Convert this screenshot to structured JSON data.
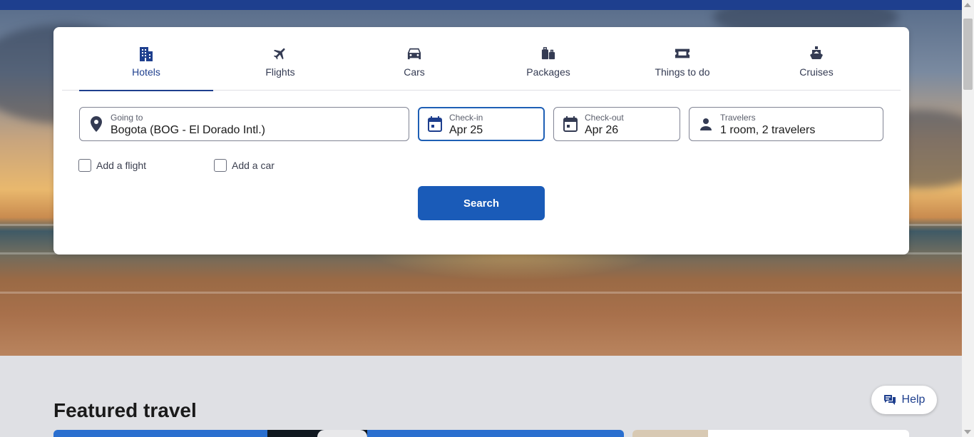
{
  "colors": {
    "brand_blue": "#1e3f8e",
    "button_blue": "#1a5bb8",
    "focus_border": "#1e5fb5",
    "page_bg": "#dfe0e4"
  },
  "tabs": [
    {
      "label": "Hotels",
      "icon": "hotel-icon",
      "active": true
    },
    {
      "label": "Flights",
      "icon": "plane-icon",
      "active": false
    },
    {
      "label": "Cars",
      "icon": "car-icon",
      "active": false
    },
    {
      "label": "Packages",
      "icon": "packages-icon",
      "active": false
    },
    {
      "label": "Things to do",
      "icon": "ticket-icon",
      "active": false
    },
    {
      "label": "Cruises",
      "icon": "cruise-ship-icon",
      "active": false
    }
  ],
  "search": {
    "going_to": {
      "label": "Going to",
      "value": "Bogota (BOG - El Dorado Intl.)",
      "icon": "location-pin-icon"
    },
    "check_in": {
      "label": "Check-in",
      "value": "Apr 25",
      "icon": "calendar-icon"
    },
    "check_out": {
      "label": "Check-out",
      "value": "Apr 26",
      "icon": "calendar-icon"
    },
    "travelers": {
      "label": "Travelers",
      "value": "1 room, 2 travelers",
      "icon": "person-icon"
    },
    "add_flight": "Add a flight",
    "add_car": "Add a car",
    "button": "Search"
  },
  "featured": {
    "title": "Featured travel"
  },
  "help": {
    "label": "Help",
    "icon": "chat-bubbles-icon"
  }
}
